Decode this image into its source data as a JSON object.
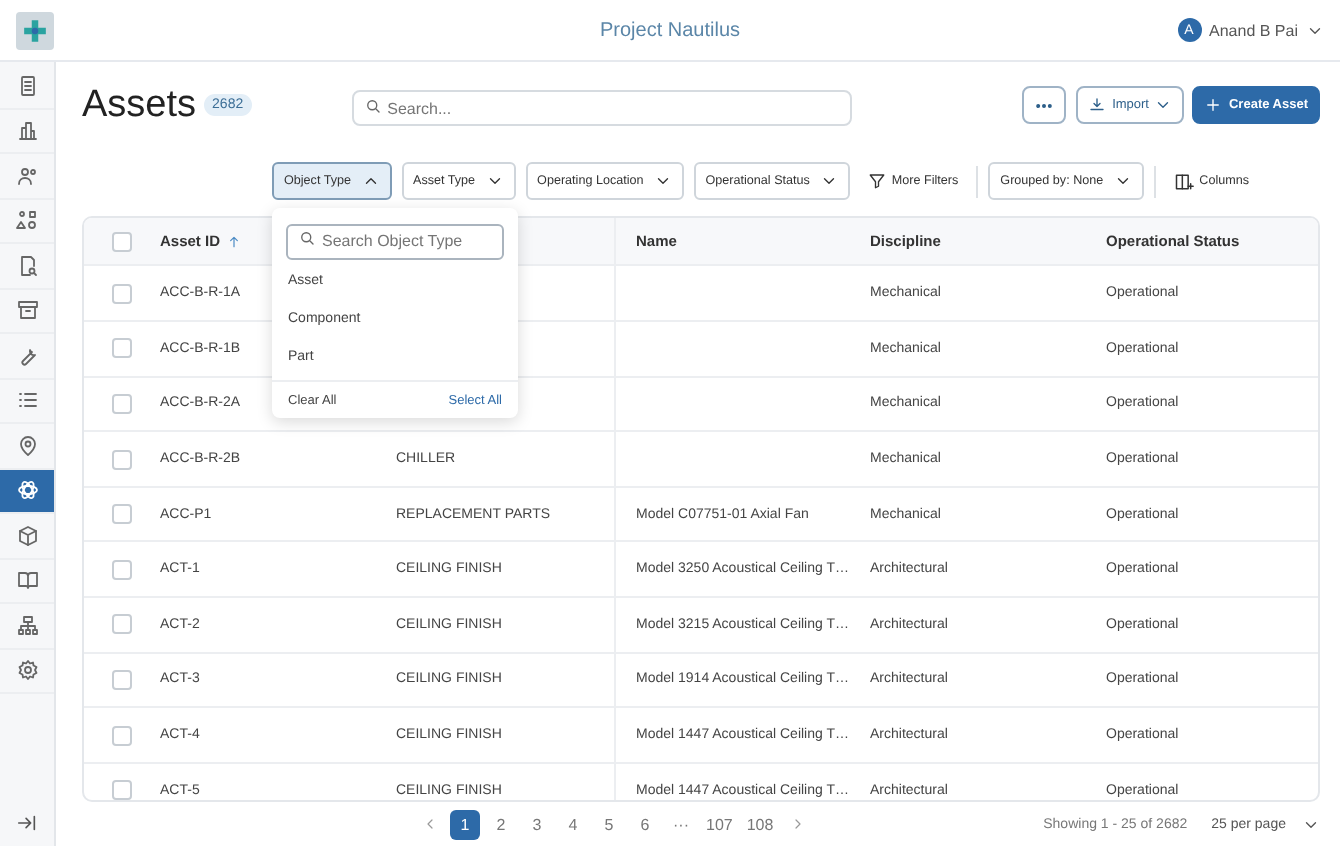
{
  "top_bar": {
    "title": "Project Nautilus",
    "user": {
      "initial": "A",
      "name": "Anand B Pai"
    }
  },
  "sidebar": {
    "items": [
      {
        "selected": false
      },
      {
        "selected": false
      },
      {
        "selected": false
      },
      {
        "selected": false
      },
      {
        "selected": false
      },
      {
        "selected": false
      },
      {
        "selected": false
      },
      {
        "selected": false
      },
      {
        "selected": false
      },
      {
        "selected": true
      },
      {
        "selected": false
      },
      {
        "selected": false
      },
      {
        "selected": false
      },
      {
        "selected": false
      }
    ]
  },
  "header": {
    "title": "Assets",
    "count": "2682",
    "search": {
      "placeholder": "Search..."
    },
    "import_label": "Import",
    "create_label": "Create Asset"
  },
  "filters": [
    {
      "kind": "dropdown",
      "label": "Object Type",
      "open": true
    },
    {
      "kind": "dropdown",
      "label": "Asset Type",
      "open": false
    },
    {
      "kind": "dropdown",
      "label": "Operating Location",
      "open": false
    },
    {
      "kind": "dropdown",
      "label": "Operational Status",
      "open": false
    },
    {
      "kind": "link",
      "label": "More Filters"
    }
  ],
  "group_by": "Grouped by: None",
  "columns_label": "Columns",
  "object_type_menu": {
    "search": {
      "placeholder": "Search Object Type"
    },
    "options": [
      "Asset",
      "Component",
      "Part"
    ],
    "clear": "Clear All",
    "select_all": "Select All"
  },
  "table": {
    "select_all_checked": false,
    "columns": [
      "Asset ID",
      "Name",
      "Discipline",
      "Operational Status"
    ],
    "rows": [
      {
        "checked": false,
        "asset_id": "ACC-B-R-1A",
        "discipline": "Mechanical",
        "status": "Operational"
      },
      {
        "checked": false,
        "asset_id": "ACC-B-R-1B",
        "discipline": "Mechanical",
        "status": "Operational"
      },
      {
        "checked": false,
        "asset_id": "ACC-B-R-2A",
        "discipline": "Mechanical",
        "status": "Operational"
      },
      {
        "checked": false,
        "asset_id": "ACC-B-R-2B",
        "type": "CHILLER",
        "discipline": "Mechanical",
        "status": "Operational"
      },
      {
        "checked": false,
        "asset_id": "ACC-P1",
        "type": "REPLACEMENT PARTS",
        "name": "Model C07751-01 Axial Fan",
        "discipline": "Mechanical",
        "status": "Operational"
      },
      {
        "checked": false,
        "asset_id": "ACT-1",
        "type": "CEILING FINISH",
        "name": "Model 3250 Acoustical Ceiling T…",
        "discipline": "Architectural",
        "status": "Operational"
      },
      {
        "checked": false,
        "asset_id": "ACT-2",
        "type": "CEILING FINISH",
        "name": "Model 3215 Acoustical Ceiling T…",
        "discipline": "Architectural",
        "status": "Operational"
      },
      {
        "checked": false,
        "asset_id": "ACT-3",
        "type": "CEILING FINISH",
        "name": "Model 1914 Acoustical Ceiling T…",
        "discipline": "Architectural",
        "status": "Operational"
      },
      {
        "checked": false,
        "asset_id": "ACT-4",
        "type": "CEILING FINISH",
        "name": "Model 1447 Acoustical Ceiling T…",
        "discipline": "Architectural",
        "status": "Operational"
      },
      {
        "checked": false,
        "asset_id": "ACT-5",
        "type": "CEILING FINISH",
        "name": "Model 1447 Acoustical Ceiling T…",
        "discipline": "Architectural",
        "status": "Operational"
      }
    ]
  },
  "pagination": {
    "pages": [
      {
        "label": "1",
        "selected": true
      },
      {
        "label": "2",
        "selected": false
      },
      {
        "label": "3",
        "selected": false
      },
      {
        "label": "4",
        "selected": false
      },
      {
        "label": "5",
        "selected": false
      },
      {
        "label": "6",
        "selected": false
      },
      {
        "label": "···",
        "selected": false
      },
      {
        "label": "107",
        "selected": false
      },
      {
        "label": "108",
        "selected": false
      }
    ],
    "summary": "Showing 1 - 25 of 2682",
    "per_page": "25 per page"
  }
}
